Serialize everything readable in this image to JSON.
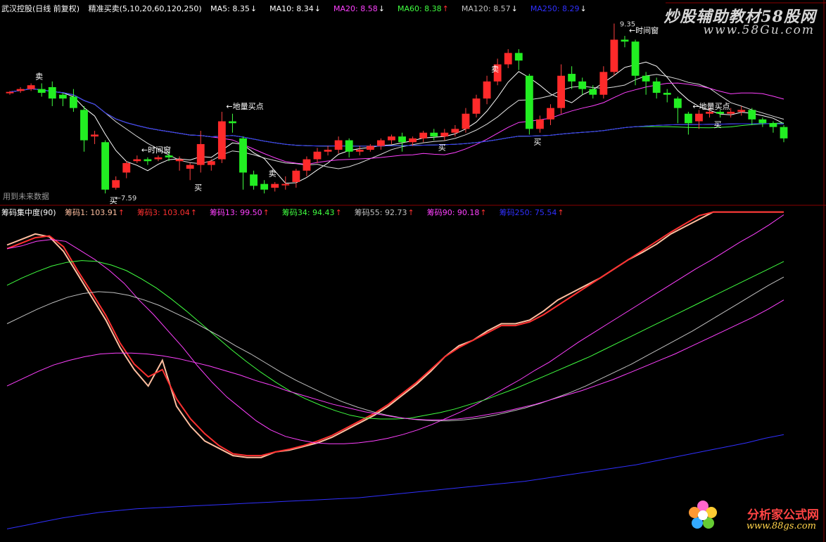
{
  "top_header": {
    "title": "武汉控股(日线 前复权)",
    "indicator": "精准买卖(5,10,20,60,120,250)",
    "items": [
      {
        "label": "MA5: 8.35",
        "arrow": "↓",
        "color": "#ffffff"
      },
      {
        "label": "MA10: 8.34",
        "arrow": "↓",
        "color": "#ffffff"
      },
      {
        "label": "MA20: 8.58",
        "arrow": "↓",
        "color": "#ff40ff"
      },
      {
        "label": "MA60: 8.38",
        "arrow": "↑",
        "color": "#40ff40"
      },
      {
        "label": "MA120: 8.57",
        "arrow": "↓",
        "color": "#c0c0c0"
      },
      {
        "label": "MA250: 8.29",
        "arrow": "↓",
        "color": "#3030ff"
      }
    ]
  },
  "bottom_header": {
    "title": "筹码集中度(90)",
    "items": [
      {
        "label": "筹码1: 103.91",
        "arrow": "↑",
        "color": "#ffbfa0"
      },
      {
        "label": "筹码3: 103.04",
        "arrow": "↑",
        "color": "#ff3030"
      },
      {
        "label": "筹码13: 99.50",
        "arrow": "↑",
        "color": "#ff40ff"
      },
      {
        "label": "筹码34: 94.43",
        "arrow": "↑",
        "color": "#40ff40"
      },
      {
        "label": "筹码55: 92.73",
        "arrow": "↑",
        "color": "#c0c0c0"
      },
      {
        "label": "筹码90: 90.18",
        "arrow": "↑",
        "color": "#ff40ff"
      },
      {
        "label": "筹码250: 75.54",
        "arrow": "↑",
        "color": "#3030ff"
      }
    ]
  },
  "watermarks": {
    "site1": "炒股辅助教材58股网",
    "site1_url": "www.58Gu.com",
    "site2": "分析家公式网",
    "site2_url": "www.88gs.com"
  },
  "left_note": "用到未来数据",
  "chart_data": [
    {
      "type": "candlestick",
      "price_labels": {
        "high": "9.35",
        "low": "7.59"
      },
      "signals": [
        {
          "text": "卖",
          "kind": "sell"
        },
        {
          "text": "卖",
          "kind": "sell"
        },
        {
          "text": "卖",
          "kind": "sell"
        },
        {
          "text": "买",
          "kind": "buy"
        },
        {
          "text": "买",
          "kind": "buy"
        },
        {
          "text": "买",
          "kind": "buy"
        },
        {
          "text": "买",
          "kind": "buy"
        },
        {
          "text": "买",
          "kind": "buy"
        },
        {
          "text": "←时间窗",
          "kind": "note"
        },
        {
          "text": "←时间窗",
          "kind": "note"
        },
        {
          "text": "←地量买点",
          "kind": "note"
        },
        {
          "text": "←地量买点",
          "kind": "note"
        }
      ],
      "candles": [
        [
          8.62,
          8.63,
          8.6,
          8.64
        ],
        [
          8.64,
          8.66,
          8.62,
          8.68
        ],
        [
          8.66,
          8.7,
          8.64,
          8.72
        ],
        [
          8.66,
          8.62,
          8.58,
          8.72
        ],
        [
          8.68,
          8.56,
          8.48,
          8.74
        ],
        [
          8.6,
          8.56,
          8.48,
          8.62
        ],
        [
          8.58,
          8.46,
          8.42,
          8.66
        ],
        [
          8.44,
          8.12,
          8.0,
          8.48
        ],
        [
          8.16,
          8.18,
          8.08,
          8.22
        ],
        [
          8.1,
          7.6,
          7.56,
          8.12
        ],
        [
          7.62,
          7.7,
          7.6,
          7.74
        ],
        [
          7.78,
          7.88,
          7.72,
          7.9
        ],
        [
          7.9,
          7.92,
          7.88,
          7.96
        ],
        [
          7.92,
          7.9,
          7.86,
          7.94
        ],
        [
          7.92,
          7.94,
          7.9,
          7.96
        ],
        [
          7.96,
          7.94,
          7.9,
          8.0
        ],
        [
          7.9,
          7.92,
          7.8,
          7.95
        ],
        [
          7.82,
          7.86,
          7.7,
          7.88
        ],
        [
          7.86,
          8.08,
          7.78,
          8.22
        ],
        [
          7.86,
          7.9,
          7.8,
          7.92
        ],
        [
          7.92,
          8.32,
          7.88,
          8.42
        ],
        [
          8.32,
          8.3,
          8.2,
          8.4
        ],
        [
          8.14,
          7.78,
          7.6,
          8.16
        ],
        [
          7.76,
          7.64,
          7.6,
          7.8
        ],
        [
          7.66,
          7.6,
          7.56,
          7.7
        ],
        [
          7.62,
          7.66,
          7.58,
          7.68
        ],
        [
          7.66,
          7.66,
          7.6,
          7.74
        ],
        [
          7.68,
          7.8,
          7.62,
          7.82
        ],
        [
          7.8,
          7.92,
          7.74,
          7.95
        ],
        [
          7.92,
          8.0,
          7.88,
          8.04
        ],
        [
          8.0,
          8.02,
          7.96,
          8.06
        ],
        [
          8.02,
          8.12,
          7.98,
          8.16
        ],
        [
          8.12,
          8.0,
          7.94,
          8.14
        ],
        [
          8.0,
          8.02,
          7.96,
          8.06
        ],
        [
          8.02,
          8.06,
          8.0,
          8.08
        ],
        [
          8.06,
          8.12,
          8.02,
          8.14
        ],
        [
          8.12,
          8.16,
          8.08,
          8.18
        ],
        [
          8.16,
          8.1,
          8.0,
          8.2
        ],
        [
          8.1,
          8.14,
          8.06,
          8.16
        ],
        [
          8.14,
          8.2,
          8.1,
          8.22
        ],
        [
          8.2,
          8.16,
          8.12,
          8.24
        ],
        [
          8.16,
          8.2,
          8.12,
          8.24
        ],
        [
          8.2,
          8.24,
          8.16,
          8.28
        ],
        [
          8.24,
          8.4,
          8.2,
          8.46
        ],
        [
          8.4,
          8.56,
          8.36,
          8.6
        ],
        [
          8.56,
          8.74,
          8.5,
          8.8
        ],
        [
          8.74,
          8.92,
          8.7,
          8.98
        ],
        [
          8.92,
          9.04,
          8.88,
          9.08
        ],
        [
          9.04,
          8.96,
          8.86,
          9.08
        ],
        [
          8.8,
          8.24,
          8.18,
          8.82
        ],
        [
          8.24,
          8.34,
          8.2,
          8.38
        ],
        [
          8.34,
          8.46,
          8.28,
          8.5
        ],
        [
          8.46,
          8.8,
          8.4,
          8.92
        ],
        [
          8.82,
          8.74,
          8.66,
          8.9
        ],
        [
          8.74,
          8.66,
          8.6,
          8.78
        ],
        [
          8.66,
          8.6,
          8.56,
          8.7
        ],
        [
          8.6,
          8.84,
          8.56,
          8.9
        ],
        [
          8.84,
          9.18,
          8.8,
          9.35
        ],
        [
          9.18,
          9.16,
          9.1,
          9.22
        ],
        [
          9.16,
          8.8,
          8.7,
          9.18
        ],
        [
          8.8,
          8.74,
          8.6,
          8.84
        ],
        [
          8.74,
          8.62,
          8.56,
          8.78
        ],
        [
          8.62,
          8.6,
          8.52,
          8.66
        ],
        [
          8.56,
          8.46,
          8.3,
          8.58
        ],
        [
          8.4,
          8.3,
          8.18,
          8.42
        ],
        [
          8.32,
          8.4,
          8.24,
          8.44
        ],
        [
          8.4,
          8.42,
          8.36,
          8.46
        ],
        [
          8.42,
          8.4,
          8.36,
          8.44
        ],
        [
          8.4,
          8.42,
          8.36,
          8.46
        ],
        [
          8.42,
          8.44,
          8.38,
          8.48
        ],
        [
          8.44,
          8.34,
          8.28,
          8.46
        ],
        [
          8.34,
          8.3,
          8.26,
          8.36
        ],
        [
          8.3,
          8.26,
          8.2,
          8.32
        ],
        [
          8.26,
          8.14,
          8.1,
          8.28
        ]
      ]
    },
    {
      "type": "line",
      "series": [
        {
          "name": "筹码1",
          "color": "#ffbfa0",
          "values": [
            96.2,
            96.8,
            97.4,
            97.1,
            95.5,
            93.0,
            90.5,
            88.0,
            85.0,
            82.6,
            80.8,
            83.6,
            78.6,
            76.4,
            74.8,
            74.0,
            73.2,
            73.0,
            73.0,
            73.6,
            73.8,
            74.2,
            74.6,
            75.2,
            76.0,
            76.8,
            77.6,
            78.6,
            79.8,
            81.0,
            82.4,
            84.0,
            85.2,
            85.8,
            86.8,
            87.6,
            87.6,
            88.0,
            89.0,
            90.2,
            91.0,
            91.8,
            92.6,
            93.6,
            94.6,
            95.4,
            96.3,
            97.4,
            98.2,
            99.0,
            99.8,
            100.6,
            101.4,
            102.3,
            103.0,
            103.9
          ]
        },
        {
          "name": "筹码3",
          "color": "#ff3030",
          "values": [
            95.8,
            96.4,
            97.0,
            97.2,
            96.0,
            93.4,
            91.0,
            88.5,
            85.5,
            83.2,
            81.8,
            82.6,
            79.4,
            77.2,
            75.6,
            74.3,
            73.4,
            73.2,
            73.2,
            73.6,
            73.9,
            74.3,
            74.8,
            75.4,
            76.2,
            77.0,
            77.8,
            78.8,
            80.0,
            81.2,
            82.6,
            84.0,
            85.0,
            85.8,
            86.6,
            87.4,
            87.4,
            87.8,
            88.6,
            89.6,
            90.6,
            91.6,
            92.6,
            93.6,
            94.6,
            95.6,
            96.6,
            97.6,
            98.5,
            99.4,
            100.2,
            101.0,
            101.8,
            102.4,
            103.0,
            103.0
          ]
        },
        {
          "name": "筹码13",
          "color": "#ff40ff",
          "values": [
            95.8,
            96.1,
            96.6,
            96.8,
            96.6,
            95.6,
            94.6,
            93.4,
            92.0,
            90.2,
            88.6,
            86.8,
            85.0,
            83.0,
            81.2,
            79.6,
            78.3,
            77.0,
            76.0,
            75.3,
            74.9,
            74.6,
            74.5,
            74.5,
            74.6,
            74.8,
            75.1,
            75.5,
            76.0,
            76.6,
            77.3,
            78.0,
            78.8,
            79.7,
            80.6,
            81.5,
            82.5,
            83.4,
            84.5,
            85.6,
            86.6,
            87.6,
            88.6,
            89.6,
            90.6,
            91.6,
            92.6,
            93.6,
            94.5,
            95.5,
            96.5,
            97.4,
            98.4,
            99.5
          ]
        },
        {
          "name": "筹码34",
          "color": "#40ff40",
          "values": [
            91.8,
            92.6,
            93.3,
            93.9,
            94.3,
            94.5,
            94.4,
            94.0,
            93.4,
            92.5,
            91.5,
            90.3,
            89.0,
            87.6,
            86.2,
            84.8,
            83.5,
            82.3,
            81.2,
            80.2,
            79.4,
            78.7,
            78.1,
            77.6,
            77.3,
            77.2,
            77.2,
            77.3,
            77.6,
            77.9,
            78.3,
            78.8,
            79.3,
            79.9,
            80.5,
            81.2,
            81.9,
            82.6,
            83.3,
            84.0,
            84.8,
            85.6,
            86.4,
            87.2,
            88.0,
            88.8,
            89.6,
            90.4,
            91.2,
            92.0,
            92.8,
            93.6,
            94.4
          ]
        },
        {
          "name": "筹码55",
          "color": "#c0c0c0",
          "values": [
            87.6,
            88.4,
            89.2,
            89.9,
            90.5,
            90.9,
            91.1,
            91.0,
            90.7,
            90.2,
            89.6,
            88.8,
            88.0,
            87.1,
            86.2,
            85.2,
            84.3,
            83.3,
            82.3,
            81.4,
            80.6,
            79.8,
            79.1,
            78.5,
            78.0,
            77.6,
            77.3,
            77.1,
            77.0,
            77.0,
            77.1,
            77.3,
            77.6,
            78.0,
            78.4,
            78.9,
            79.5,
            80.1,
            80.8,
            81.6,
            82.4,
            83.2,
            84.1,
            85.0,
            85.9,
            86.8,
            87.8,
            88.8,
            89.8,
            90.8,
            91.8,
            92.7
          ]
        },
        {
          "name": "筹码90",
          "color": "#ff40ff",
          "values": [
            80.8,
            81.6,
            82.4,
            83.1,
            83.6,
            84.0,
            84.3,
            84.4,
            84.4,
            84.3,
            84.1,
            83.8,
            83.4,
            83.0,
            82.5,
            82.0,
            81.4,
            80.9,
            80.3,
            79.8,
            79.3,
            78.8,
            78.4,
            78.0,
            77.7,
            77.4,
            77.2,
            77.1,
            77.1,
            77.2,
            77.4,
            77.7,
            78.0,
            78.4,
            78.8,
            79.3,
            79.8,
            80.3,
            80.9,
            81.5,
            82.2,
            82.9,
            83.6,
            84.3,
            85.1,
            85.9,
            86.7,
            87.5,
            88.3,
            89.2,
            90.2
          ]
        },
        {
          "name": "筹码250",
          "color": "#3030ff",
          "values": [
            65.2,
            65.6,
            66.0,
            66.4,
            66.7,
            67.0,
            67.2,
            67.4,
            67.5,
            67.6,
            67.7,
            67.8,
            67.9,
            68.0,
            68.1,
            68.2,
            68.3,
            68.4,
            68.5,
            68.6,
            68.8,
            69.0,
            69.2,
            69.4,
            69.6,
            69.8,
            70.0,
            70.2,
            70.4,
            70.7,
            71.0,
            71.3,
            71.6,
            71.9,
            72.2,
            72.6,
            73.0,
            73.4,
            73.8,
            74.2,
            74.6,
            75.1,
            75.5
          ]
        }
      ]
    }
  ]
}
